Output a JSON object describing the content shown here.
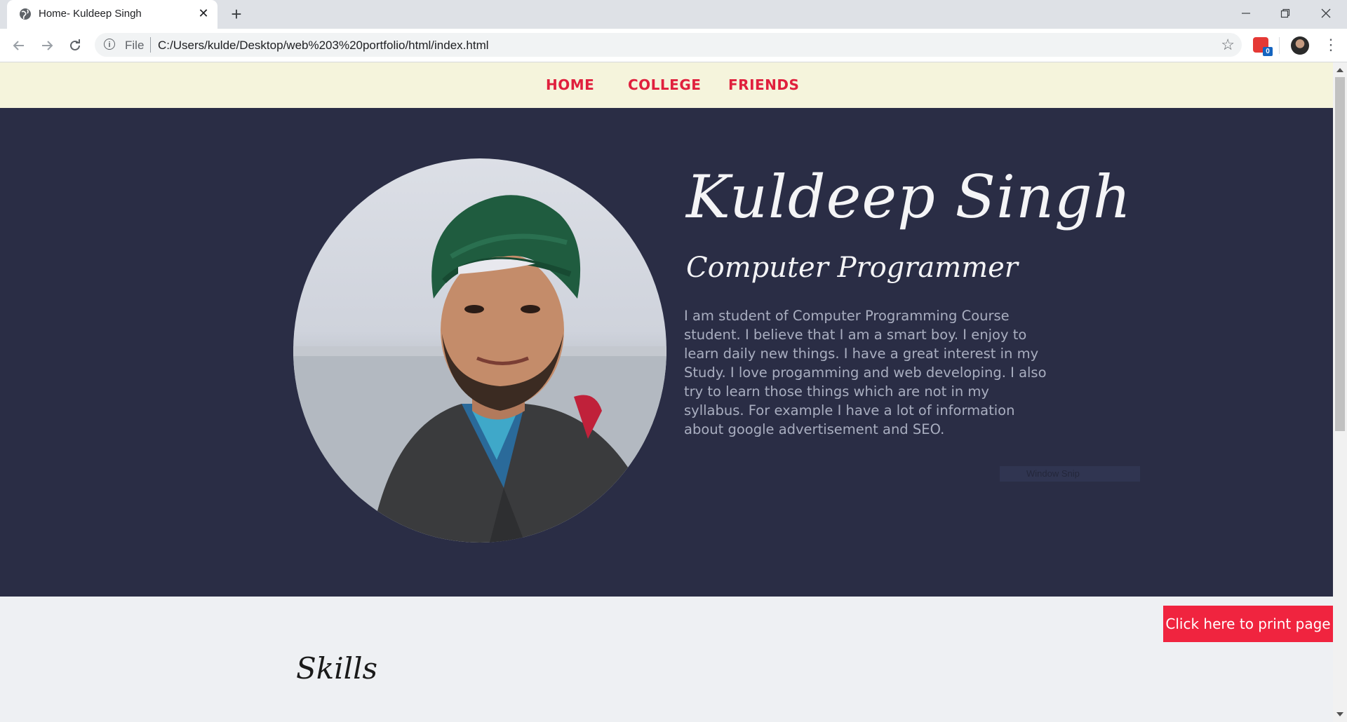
{
  "browser": {
    "tab_title": "Home- Kuldeep Singh",
    "tab_close": "✕",
    "new_tab": "+",
    "url_scheme": "File",
    "url": "C:/Users/kulde/Desktop/web%203%20portfolio/html/index.html",
    "extension_badge": "0",
    "icons": [
      "globe-icon",
      "close-icon",
      "plus-icon",
      "back-icon",
      "forward-icon",
      "reload-icon",
      "info-icon",
      "star-icon",
      "extension-icon",
      "profile-avatar",
      "menu-icon",
      "minimize-icon",
      "restore-icon",
      "window-close-icon"
    ]
  },
  "site": {
    "nav": [
      "HOME",
      "COLLEGE",
      "FRIENDS"
    ],
    "name": "Kuldeep Singh",
    "role": "Computer Programmer",
    "bio": "I am student of Computer Programming Course student. I believe that I am a smart boy. I enjoy to learn daily new things. I have a great interest in my Study. I love progamming and web developing. I also try to learn those things which are not in my syllabus. For example I have a lot of information about google advertisement and SEO.",
    "overlay_text": "Window Snip",
    "print_button": "Click here to print page",
    "skills_heading": "Skills"
  },
  "colors": {
    "nav_bg": "#f5f4dc",
    "nav_link": "#e0203d",
    "hero_bg": "#2a2d45",
    "print_button_bg": "#f0243f",
    "page_bg": "#eef0f3"
  }
}
